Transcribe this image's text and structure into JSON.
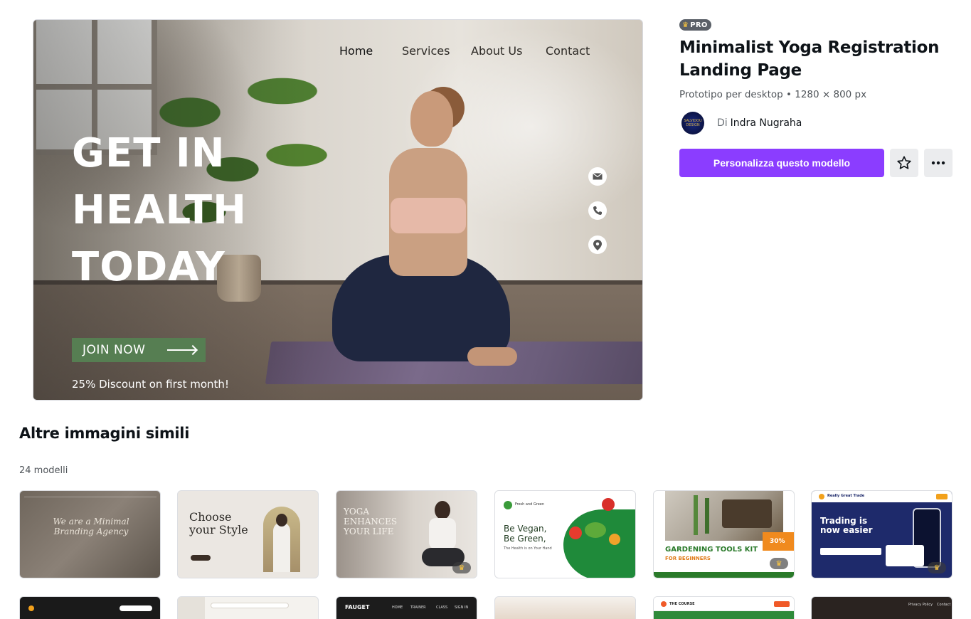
{
  "hero": {
    "nav": [
      "Home",
      "Services",
      "About Us",
      "Contact"
    ],
    "headline": [
      "GET IN",
      "HEALTH",
      "TODAY"
    ],
    "cta_label": "JOIN NOW",
    "discount": "25% Discount on first month!",
    "contact_icons": [
      "mail-icon",
      "phone-icon",
      "location-pin-icon"
    ]
  },
  "panel": {
    "badge": "PRO",
    "title": "Minimalist Yoga Registration Landing Page",
    "meta": "Prototipo per desktop • 1280 × 800 px",
    "author_prefix": "Di",
    "author": "Indra Nugraha",
    "avatar_text": "SALVIDOU DESIGN",
    "cta": "Personalizza questo modello",
    "accent": "#8b3dff"
  },
  "similar": {
    "title": "Altre immagini simili",
    "count": "24 modelli",
    "thumbs": [
      {
        "headline": "We are a Minimal Branding Agency",
        "pro": false
      },
      {
        "headline": "Choose your Style",
        "pro": false
      },
      {
        "headline": "YOGA ENHANCES YOUR LIFE",
        "pro": true
      },
      {
        "headline": "Be Vegan, Be Green,",
        "sub": "The Health is on Your Hand",
        "brand": "Fresh and Green",
        "pro": false
      },
      {
        "headline": "GARDENING TOOLS KIT",
        "sub": "FOR BEGINNERS",
        "discount": "30%",
        "pro": true
      },
      {
        "headline": "Trading is now easier",
        "brand": "Really Great Trade",
        "pro": true
      }
    ],
    "row2": [
      {
        "text": ""
      },
      {
        "text": ""
      },
      {
        "brand": "FAUGET",
        "nav": [
          "HOME",
          "TRAINER",
          "CLASS",
          "SIGN IN"
        ]
      },
      {
        "text": ""
      },
      {
        "brand": "THE COURSE"
      },
      {
        "nav": [
          "Privacy Policy",
          "Contact"
        ]
      }
    ]
  }
}
